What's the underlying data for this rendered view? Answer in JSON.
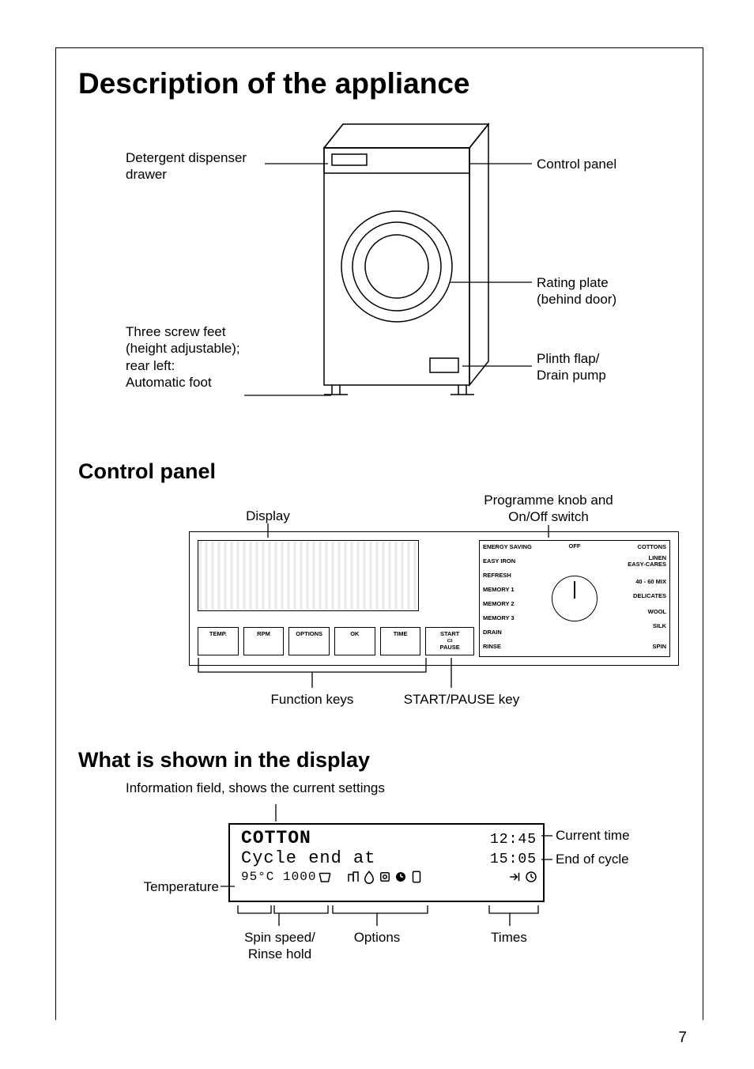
{
  "page": {
    "number": "7"
  },
  "headings": {
    "main": "Description of the appliance",
    "control_panel": "Control panel",
    "display_section": "What is shown in the display"
  },
  "appliance_callouts": {
    "detergent_drawer": "Detergent dispenser drawer",
    "control_panel": "Control panel",
    "rating_plate": "Rating plate\n(behind door)",
    "feet": "Three screw feet\n(height adjustable);\nrear left:\nAutomatic foot",
    "plinth": "Plinth flap/\nDrain pump"
  },
  "panel_callouts": {
    "display": "Display",
    "knob": "Programme knob and\nOn/Off switch",
    "function_keys": "Function keys",
    "start_pause_key": "START/PAUSE key"
  },
  "panel_keys": {
    "temp": "TEMP.",
    "rpm": "RPM",
    "options": "OPTIONS",
    "ok": "OK",
    "time": "TIME",
    "start_pause": "START\n▭\nPAUSE"
  },
  "knob_labels": {
    "left": [
      "ENERGY SAVING",
      "EASY IRON",
      "REFRESH",
      "MEMORY 1",
      "MEMORY 2",
      "MEMORY 3",
      "DRAIN",
      "RINSE"
    ],
    "top": "OFF",
    "right": [
      "COTTONS",
      "LINEN\nEASY-CARES",
      "40 - 60 MIX",
      "DELICATES",
      "WOOL",
      "SILK",
      "SPIN"
    ]
  },
  "display_intro": "Information field, shows the current settings",
  "display": {
    "line1_left": "COTTON",
    "line1_right": "12:45",
    "line2_left": "Cycle end at",
    "line2_right": "15:05",
    "line3_lead": "95°C 1000"
  },
  "display_callouts": {
    "current_time": "Current time",
    "end_of_cycle": "End of cycle",
    "temperature": "Temperature",
    "spin_speed": "Spin speed/\nRinse hold",
    "options": "Options",
    "times": "Times"
  }
}
